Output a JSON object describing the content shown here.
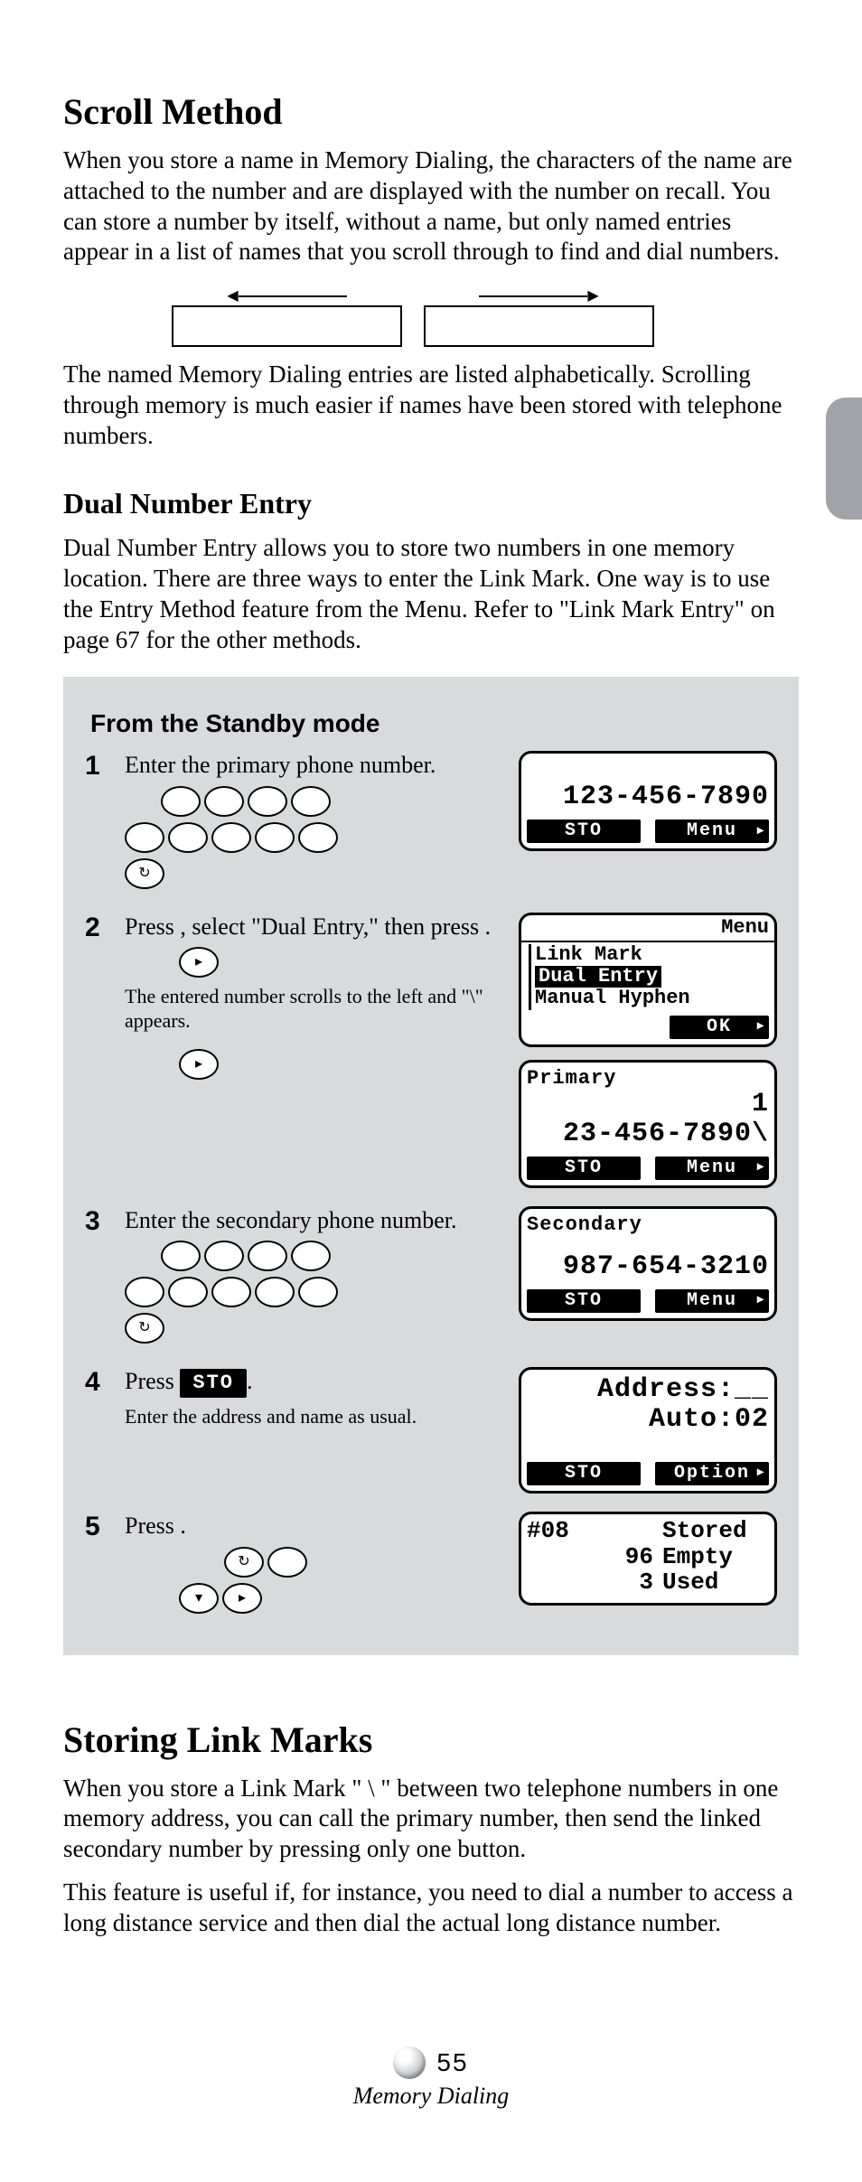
{
  "header": {
    "title1": "Scroll Method",
    "p1": "When you store a name in Memory Dialing, the characters of the name are attached to the number and are displayed with the number on recall. You can store a number by itself, without a name, but only named entries appear in a list of names that you scroll through to find and dial numbers.",
    "p2": "The named Memory Dialing entries are listed alphabetically. Scrolling through memory is much easier if names have been stored with telephone numbers.",
    "sub": "Dual Number Entry",
    "p3": "Dual Number Entry allows you to store two numbers in one memory location. There are three ways to enter the Link Mark. One way is to use the Entry Method feature from the Menu. Refer to \"Link Mark Entry\" on page 67 for the other methods."
  },
  "panel": {
    "title": "From the Standby mode",
    "steps": [
      {
        "n": "1",
        "txt": "Enter the primary phone number."
      },
      {
        "n": "2",
        "txt": "Press         , select \"Dual Entry,\" then press         .",
        "note": "The entered number scrolls to the left and \"\\\" appears."
      },
      {
        "n": "3",
        "txt": "Enter the secondary phone number."
      },
      {
        "n": "4",
        "txt": "Press            .",
        "note": "Enter the address and name as usual."
      },
      {
        "n": "5",
        "txt": "Press                     ."
      }
    ]
  },
  "lcd": {
    "s1_num": "123-456-7890",
    "sk_sto": "STO",
    "sk_menu": "Menu",
    "s2_hdr": "Menu",
    "s2_l1": "Link Mark",
    "s2_l2": "Dual Entry",
    "s2_l3": "Manual Hyphen",
    "sk_ok": "OK",
    "s3_hdr": "Primary",
    "s3_r1": "1",
    "s3_r2": "23-456-7890\\",
    "s4_hdr": "Secondary",
    "s4_num": "987-654-3210",
    "s5_l1": "Address:__",
    "s5_l2": "Auto:02",
    "sk_option": "Option",
    "s6_a": "#08",
    "s6_b": "",
    "s6_c": "Stored",
    "s6_d": "",
    "s6_e": "96",
    "s6_f": "Empty",
    "s6_g": "",
    "s6_h": "3",
    "s6_i": "Used"
  },
  "lower": {
    "title": "Storing Link Marks",
    "p1": "When you store a Link Mark \" \\ \" between two telephone numbers in one memory address, you can call the primary number, then send the linked secondary number by pressing only one button.",
    "p2": "This feature is useful if, for instance, you need to dial a number to access a long distance service and then dial the actual long distance number."
  },
  "footer": {
    "page": "55",
    "section": "Memory Dialing"
  }
}
